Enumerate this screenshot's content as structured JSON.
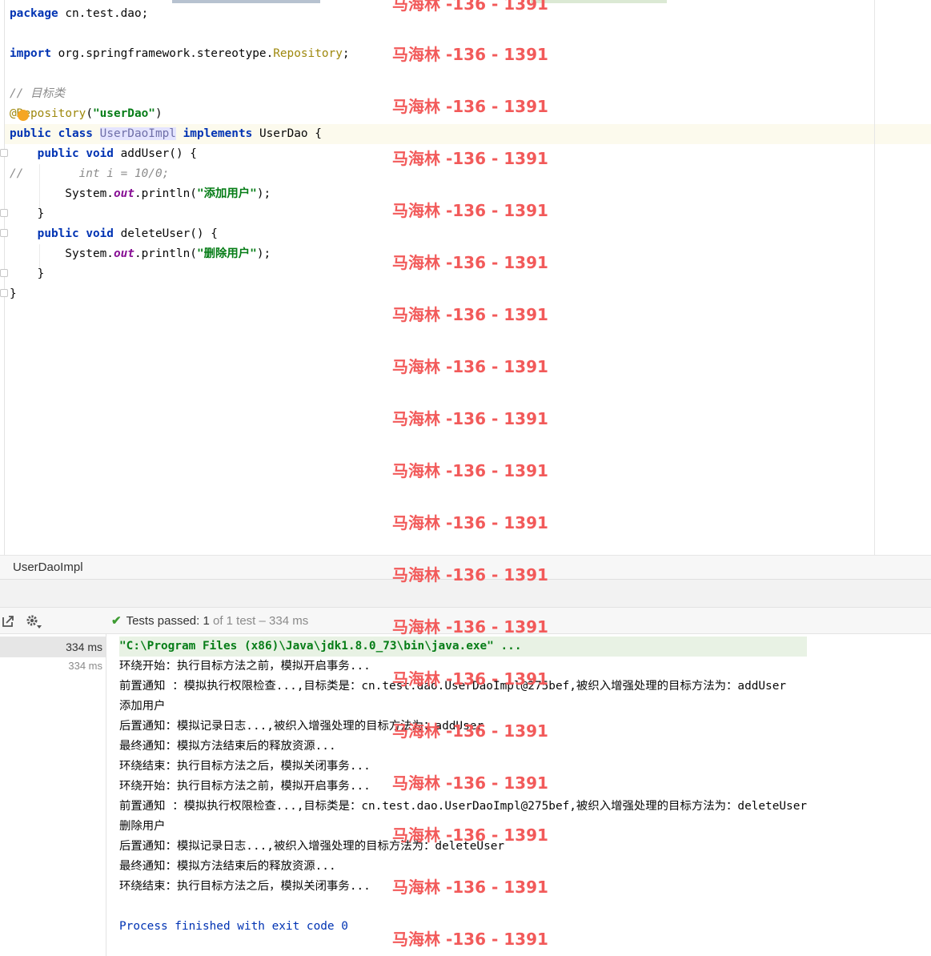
{
  "editor": {
    "lines": [
      [
        {
          "t": "package",
          "c": "kw"
        },
        {
          "t": " cn.test.dao;"
        }
      ],
      [],
      [
        {
          "t": "import",
          "c": "kw"
        },
        {
          "t": " org.springframework.stereotype."
        },
        {
          "t": "Repository",
          "c": "ann"
        },
        {
          "t": ";"
        }
      ],
      [],
      [
        {
          "t": "// 目标类",
          "c": "cmt"
        }
      ],
      [
        {
          "t": "@",
          "c": "ann"
        },
        {
          "t": "Repository",
          "c": "ann"
        },
        {
          "t": "("
        },
        {
          "t": "\"userDao\"",
          "c": "str"
        },
        {
          "t": ")"
        }
      ],
      [
        {
          "t": "public",
          "c": "kw"
        },
        {
          "t": " "
        },
        {
          "t": "class",
          "c": "kw"
        },
        {
          "t": " "
        },
        {
          "t": "UserDaoImpl",
          "c": "hl"
        },
        {
          "t": " "
        },
        {
          "t": "implements",
          "c": "kw"
        },
        {
          "t": " UserDao {"
        }
      ],
      [
        {
          "t": "    "
        },
        {
          "t": "public",
          "c": "kw"
        },
        {
          "t": " "
        },
        {
          "t": "void",
          "c": "kw"
        },
        {
          "t": " addUser() {"
        }
      ],
      [
        {
          "t": "//",
          "c": "cmt"
        },
        {
          "t": "        int i = 10/0;",
          "c": "cmt"
        }
      ],
      [
        {
          "t": "        System."
        },
        {
          "t": "out",
          "c": "fld"
        },
        {
          "t": ".println("
        },
        {
          "t": "\"添加用户\"",
          "c": "str"
        },
        {
          "t": ");"
        }
      ],
      [
        {
          "t": "    }"
        }
      ],
      [
        {
          "t": "    "
        },
        {
          "t": "public",
          "c": "kw"
        },
        {
          "t": " "
        },
        {
          "t": "void",
          "c": "kw"
        },
        {
          "t": " deleteUser() {"
        }
      ],
      [
        {
          "t": "        System."
        },
        {
          "t": "out",
          "c": "fld"
        },
        {
          "t": ".println("
        },
        {
          "t": "\"删除用户\"",
          "c": "str"
        },
        {
          "t": ");"
        }
      ],
      [
        {
          "t": "    }"
        }
      ],
      [
        {
          "t": "}"
        }
      ]
    ]
  },
  "breadcrumb": {
    "label": "UserDaoImpl"
  },
  "test_bar": {
    "check_icon": "check-icon",
    "passed_label": "Tests passed:",
    "passed_count": "1",
    "of_label": "of 1 test",
    "separator": "–",
    "duration": "334 ms"
  },
  "tree": {
    "rows": [
      "334 ms",
      "334 ms"
    ]
  },
  "console": {
    "lines": [
      {
        "text": "\"C:\\Program Files (x86)\\Java\\jdk1.8.0_73\\bin\\java.exe\" ...",
        "kind": "cmd"
      },
      {
        "text": "环绕开始：执行目标方法之前，模拟开启事务..."
      },
      {
        "text": "前置通知 ：模拟执行权限检查...,目标类是：cn.test.dao.UserDaoImpl@275bef,被织入增强处理的目标方法为：addUser"
      },
      {
        "text": "添加用户"
      },
      {
        "text": "后置通知：模拟记录日志...,被织入增强处理的目标方法为：addUser"
      },
      {
        "text": "最终通知：模拟方法结束后的释放资源..."
      },
      {
        "text": "环绕结束：执行目标方法之后，模拟关闭事务..."
      },
      {
        "text": "环绕开始：执行目标方法之前，模拟开启事务..."
      },
      {
        "text": "前置通知 ：模拟执行权限检查...,目标类是：cn.test.dao.UserDaoImpl@275bef,被织入增强处理的目标方法为：deleteUser"
      },
      {
        "text": "删除用户"
      },
      {
        "text": "后置通知：模拟记录日志...,被织入增强处理的目标方法为：deleteUser"
      },
      {
        "text": "最终通知：模拟方法结束后的释放资源..."
      },
      {
        "text": "环绕结束：执行目标方法之后，模拟关闭事务..."
      },
      {
        "text": ""
      },
      {
        "text": "Process finished with exit code 0",
        "kind": "sys"
      }
    ]
  },
  "watermark": {
    "text": "马海林 -136 - 1391",
    "color": "#f25a5a"
  },
  "icons": {
    "export": "export-icon",
    "settings": "gear-icon",
    "intention": "lightbulb-icon"
  },
  "colors": {
    "keyword": "#0033b3",
    "string": "#067d17",
    "annotation": "#9e880d",
    "comment": "#8c8c8c",
    "pass": "#3d9b32"
  }
}
